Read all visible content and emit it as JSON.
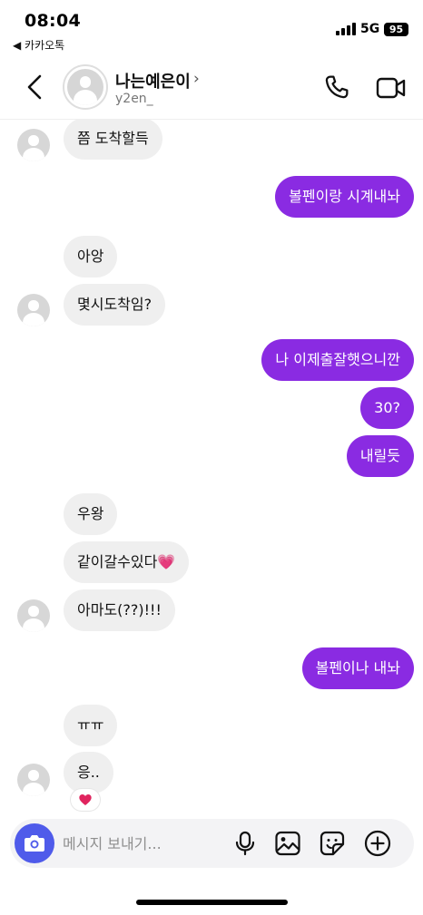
{
  "status_bar": {
    "time": "08:04",
    "back_app": "◀ 카카오톡",
    "network": "5G",
    "battery": "95"
  },
  "header": {
    "contact_name": "나는예은이",
    "contact_id": "y2en_",
    "chevron": "›"
  },
  "messages": [
    {
      "side": "in",
      "text": "쯤 도착할득",
      "avatar": true
    },
    {
      "side": "out",
      "text": "볼펜이랑 시계내놔"
    },
    {
      "side": "in",
      "text": "아앙",
      "avatar": false
    },
    {
      "side": "in",
      "text": "몇시도착임?",
      "avatar": true
    },
    {
      "side": "out",
      "text": "나 이제출잘햇으니깐"
    },
    {
      "side": "out",
      "text": "30?"
    },
    {
      "side": "out",
      "text": "내릴듯"
    },
    {
      "side": "in",
      "text": "우왕",
      "avatar": false
    },
    {
      "side": "in",
      "text": "같이갈수있다💗",
      "avatar": false
    },
    {
      "side": "in",
      "text": "아마도(??)!!!",
      "avatar": true
    },
    {
      "side": "out",
      "text": "볼펜이나 내놔"
    },
    {
      "side": "in",
      "text": "ㅠㅠ",
      "avatar": false
    },
    {
      "side": "in",
      "text": "응..",
      "avatar": true
    }
  ],
  "reaction": {
    "emoji": "❤️",
    "icon": "heart-icon",
    "color": "#e0245e"
  },
  "composer": {
    "placeholder": "메시지 보내기..."
  },
  "colors": {
    "outgoing_bubble": "#8a2be2",
    "incoming_bubble": "#efefef",
    "camera_button": "#4f5bea"
  }
}
